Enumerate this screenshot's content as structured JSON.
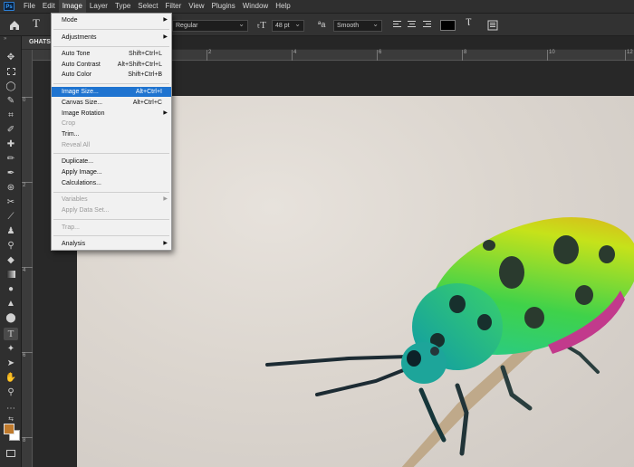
{
  "app": {
    "logo": "Ps"
  },
  "menubar": {
    "items": [
      "File",
      "Edit",
      "Image",
      "Layer",
      "Type",
      "Select",
      "Filter",
      "View",
      "Plugins",
      "Window",
      "Help"
    ],
    "active_index": 2
  },
  "options": {
    "font_style": "Regular",
    "font_size": "48 pt",
    "aa_label": "ªa",
    "antialias": "Smooth",
    "color_swatch": "#000000"
  },
  "document": {
    "tab_title": "GHATS"
  },
  "ruler": {
    "top_labels": [
      "2",
      "4",
      "6",
      "8",
      "10",
      "12"
    ],
    "left_labels": [
      "0",
      "2",
      "4",
      "6",
      "8",
      "10"
    ]
  },
  "image_menu": {
    "items": [
      {
        "label": "Mode",
        "shortcut": "",
        "submenu": true,
        "disabled": false
      },
      {
        "label": "Adjustments",
        "shortcut": "",
        "submenu": true,
        "disabled": false
      },
      {
        "label": "Auto Tone",
        "shortcut": "Shift+Ctrl+L",
        "submenu": false,
        "disabled": false
      },
      {
        "label": "Auto Contrast",
        "shortcut": "Alt+Shift+Ctrl+L",
        "submenu": false,
        "disabled": false
      },
      {
        "label": "Auto Color",
        "shortcut": "Shift+Ctrl+B",
        "submenu": false,
        "disabled": false
      },
      {
        "label": "Image Size...",
        "shortcut": "Alt+Ctrl+I",
        "submenu": false,
        "disabled": false,
        "highlighted": true
      },
      {
        "label": "Canvas Size...",
        "shortcut": "Alt+Ctrl+C",
        "submenu": false,
        "disabled": false
      },
      {
        "label": "Image Rotation",
        "shortcut": "",
        "submenu": true,
        "disabled": false
      },
      {
        "label": "Crop",
        "shortcut": "",
        "submenu": false,
        "disabled": true
      },
      {
        "label": "Trim...",
        "shortcut": "",
        "submenu": false,
        "disabled": false
      },
      {
        "label": "Reveal All",
        "shortcut": "",
        "submenu": false,
        "disabled": true
      },
      {
        "label": "Duplicate...",
        "shortcut": "",
        "submenu": false,
        "disabled": false
      },
      {
        "label": "Apply Image...",
        "shortcut": "",
        "submenu": false,
        "disabled": false
      },
      {
        "label": "Calculations...",
        "shortcut": "",
        "submenu": false,
        "disabled": false
      },
      {
        "label": "Variables",
        "shortcut": "",
        "submenu": true,
        "disabled": true
      },
      {
        "label": "Apply Data Set...",
        "shortcut": "",
        "submenu": false,
        "disabled": true
      },
      {
        "label": "Trap...",
        "shortcut": "",
        "submenu": false,
        "disabled": true
      },
      {
        "label": "Analysis",
        "shortcut": "",
        "submenu": true,
        "disabled": false
      }
    ]
  },
  "colors": {
    "foreground": "#c07a2c",
    "background": "#ffffff",
    "menu_highlight": "#1f74d0"
  }
}
